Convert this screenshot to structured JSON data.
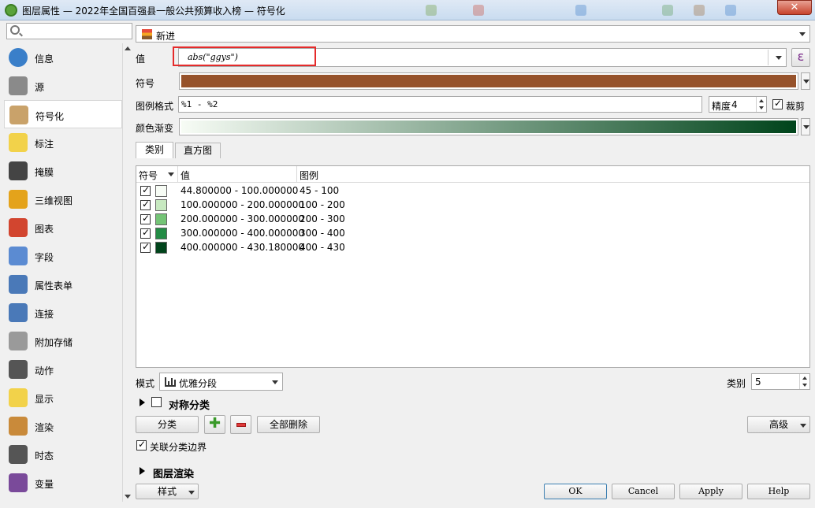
{
  "window": {
    "title": "图层属性 — 2022年全国百强县一般公共预算收入榜 — 符号化",
    "close_label": "✕"
  },
  "search": {
    "placeholder": ""
  },
  "sidebar": {
    "items": [
      {
        "label": "信息",
        "icon": "info-icon",
        "color": "#3a7fc9"
      },
      {
        "label": "源",
        "icon": "source-icon",
        "color": "#8a8a8a"
      },
      {
        "label": "符号化",
        "icon": "symbology-icon",
        "color": "#c9a26a"
      },
      {
        "label": "标注",
        "icon": "labels-icon",
        "color": "#f2d24a"
      },
      {
        "label": "掩膜",
        "icon": "mask-icon",
        "color": "#444444"
      },
      {
        "label": "三维视图",
        "icon": "3d-view-icon",
        "color": "#e4a31b"
      },
      {
        "label": "图表",
        "icon": "diagram-icon",
        "color": "#d2452f"
      },
      {
        "label": "字段",
        "icon": "fields-icon",
        "color": "#5b8bd2"
      },
      {
        "label": "属性表单",
        "icon": "attribute-form-icon",
        "color": "#4a79b8"
      },
      {
        "label": "连接",
        "icon": "joins-icon",
        "color": "#4a79b8"
      },
      {
        "label": "附加存储",
        "icon": "auxiliary-storage-icon",
        "color": "#9a9a9a"
      },
      {
        "label": "动作",
        "icon": "actions-icon",
        "color": "#555555"
      },
      {
        "label": "显示",
        "icon": "display-icon",
        "color": "#f2d24a"
      },
      {
        "label": "渲染",
        "icon": "rendering-icon",
        "color": "#c98a3a"
      },
      {
        "label": "时态",
        "icon": "temporal-icon",
        "color": "#555555"
      },
      {
        "label": "变量",
        "icon": "variables-icon",
        "color": "#7a4a9a"
      }
    ]
  },
  "renderer": {
    "type": "新进"
  },
  "value": {
    "label": "值",
    "expression": "abs(\"ggys\")",
    "expr_button": "ε"
  },
  "symbol": {
    "label": "符号",
    "color": "#96522b"
  },
  "legend_format": {
    "label": "图例格式",
    "value": "%1 - %2",
    "precision_label": "精度",
    "precision": "4",
    "trim_label": "裁剪"
  },
  "color_ramp": {
    "label": "颜色渐变",
    "start": "#f7fcf5",
    "end": "#00441b"
  },
  "tabs": [
    {
      "label": "类别"
    },
    {
      "label": "直方图"
    }
  ],
  "table": {
    "headers": {
      "symbol": "符号",
      "value": "值",
      "legend": "图例"
    },
    "rows": [
      {
        "value": "44.800000 - 100.000000",
        "legend": "45 - 100",
        "color": "#f7fcf5"
      },
      {
        "value": "100.000000 - 200.000000",
        "legend": "100 - 200",
        "color": "#c7e9c0"
      },
      {
        "value": "200.000000 - 300.000000",
        "legend": "200 - 300",
        "color": "#74c476"
      },
      {
        "value": "300.000000 - 400.000000",
        "legend": "300 - 400",
        "color": "#238b45"
      },
      {
        "value": "400.000000 - 430.180000",
        "legend": "400 - 430",
        "color": "#00441b"
      }
    ]
  },
  "mode": {
    "label": "模式",
    "value": "优雅分段"
  },
  "classes": {
    "label": "类别",
    "value": "5"
  },
  "symmetric": {
    "label": "对称分类"
  },
  "buttons": {
    "classify": "分类",
    "delete_all": "全部删除",
    "advanced": "高级"
  },
  "link_boundaries": {
    "label": "关联分类边界"
  },
  "layer_rendering": {
    "label": "图层渲染"
  },
  "bottom": {
    "style": "样式",
    "ok": "OK",
    "cancel": "Cancel",
    "apply": "Apply",
    "help": "Help"
  }
}
